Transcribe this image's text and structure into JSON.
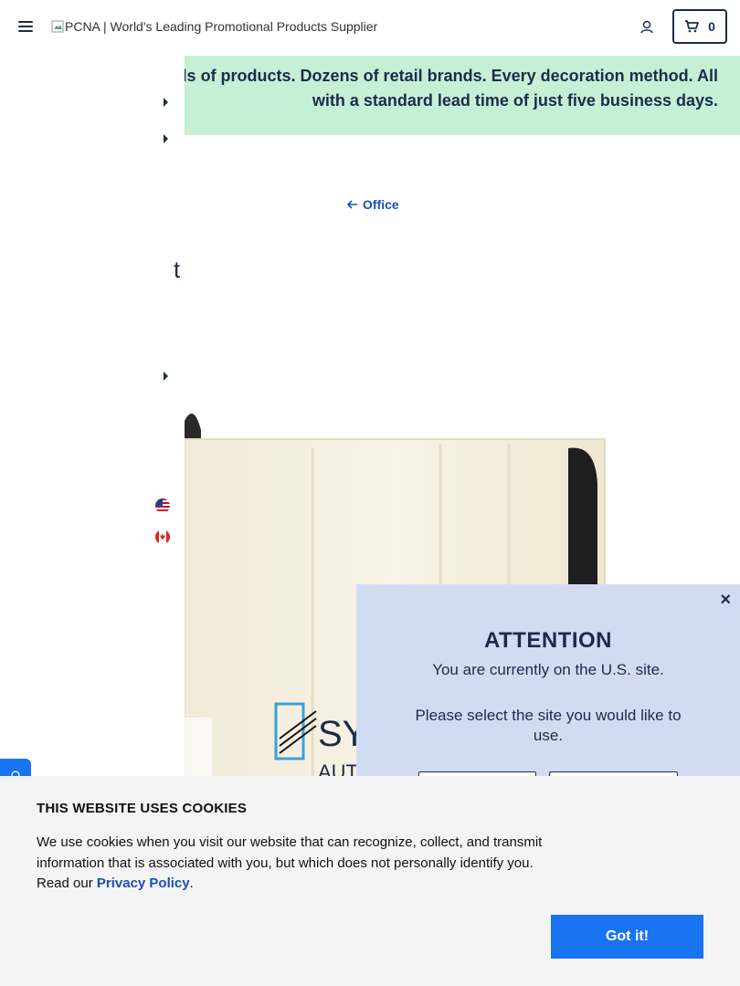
{
  "header": {
    "logo_alt": "PCNA | World's Leading Promotional Products Supplier",
    "cart_count": "0"
  },
  "banner": {
    "text_line1": "Thousands of products. Dozens of retail brands. Every decoration method. All",
    "text_line2": "with a standard lead time of just five business days."
  },
  "breadcrumb": {
    "label": "Office"
  },
  "sidebar": {
    "partial_char": "t"
  },
  "modal": {
    "title": "ATTENTION",
    "line1": "You are currently on the U.S. site.",
    "line2": "Please select the site you would like to use.",
    "close": "×",
    "buttons": [
      "",
      ""
    ]
  },
  "cookie": {
    "title": "THIS WEBSITE USES COOKIES",
    "body": "We use cookies when you visit our website that can recognize, collect, and transmit information that is associated with you, but which does not personally identify you. Read our ",
    "link": "Privacy Policy",
    "end": ".",
    "button": "Got it!"
  },
  "colors": {
    "navy": "#1c2b4a",
    "accent": "#1a73f0",
    "banner_bg": "#c6f0d6",
    "modal_bg": "#d1dcf3"
  },
  "icons": [
    "hamburger-icon",
    "user-icon",
    "cart-icon",
    "caret-right-icon",
    "us-flag-icon",
    "canada-flag-icon",
    "arrow-left-icon",
    "close-icon",
    "chat-icon"
  ]
}
